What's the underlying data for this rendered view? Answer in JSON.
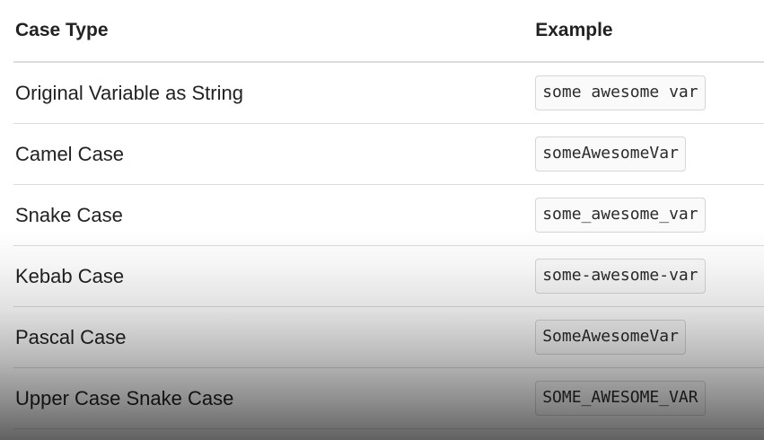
{
  "table": {
    "headers": {
      "case_type": "Case Type",
      "example": "Example"
    },
    "rows": [
      {
        "case_type": "Original Variable as String",
        "example": "some awesome var"
      },
      {
        "case_type": "Camel Case",
        "example": "someAwesomeVar"
      },
      {
        "case_type": "Snake Case",
        "example": "some_awesome_var"
      },
      {
        "case_type": "Kebab Case",
        "example": "some-awesome-var"
      },
      {
        "case_type": "Pascal Case",
        "example": "SomeAwesomeVar"
      },
      {
        "case_type": "Upper Case Snake Case",
        "example": "SOME_AWESOME_VAR"
      }
    ]
  }
}
